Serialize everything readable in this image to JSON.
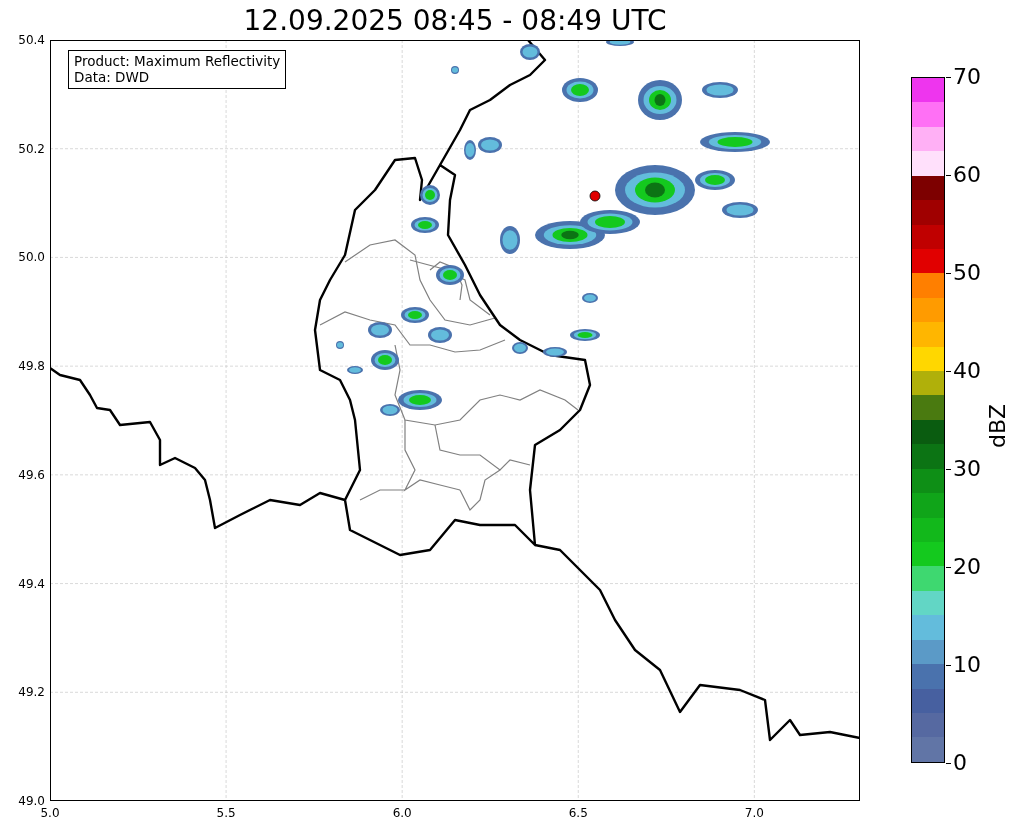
{
  "title": "12.09.2025 08:45 - 08:49 UTC",
  "map": {
    "legend": [
      "Product: Maximum Reflectivity",
      "Data: DWD"
    ],
    "xticks": [
      "5.0",
      "5.5",
      "6.0",
      "6.5",
      "7.0"
    ],
    "yticks": [
      "50.4",
      "50.2",
      "50.0",
      "49.8",
      "49.6",
      "49.4",
      "49.2",
      "49.0"
    ]
  },
  "colorbar": {
    "label": "dBZ",
    "ticks": [
      "70",
      "60",
      "50",
      "40",
      "30",
      "20",
      "10",
      "0"
    ],
    "colors": [
      {
        "color": "#ee35ee"
      },
      {
        "color": "#ff70f5"
      },
      {
        "color": "#ffb0f5"
      },
      {
        "color": "#ffe0fb"
      },
      {
        "color": "#7d0000"
      },
      {
        "color": "#a00000"
      },
      {
        "color": "#c00000"
      },
      {
        "color": "#e10000"
      },
      {
        "color": "#ff7f00"
      },
      {
        "color": "#ff9b00"
      },
      {
        "color": "#ffb600"
      },
      {
        "color": "#ffd700"
      },
      {
        "color": "#b0b00a"
      },
      {
        "color": "#4a7a10"
      },
      {
        "color": "#0a5c10"
      },
      {
        "color": "#0c7414"
      },
      {
        "color": "#0e8f16"
      },
      {
        "color": "#10a519"
      },
      {
        "color": "#12b81b"
      },
      {
        "color": "#14c91e"
      },
      {
        "color": "#3ed870"
      },
      {
        "color": "#62d6c5"
      },
      {
        "color": "#63bcdc"
      },
      {
        "color": "#5b9ac7"
      },
      {
        "color": "#4a72ad"
      },
      {
        "color": "#4760a0"
      },
      {
        "color": "#5669a1"
      },
      {
        "color": "#6175a6"
      }
    ]
  }
}
